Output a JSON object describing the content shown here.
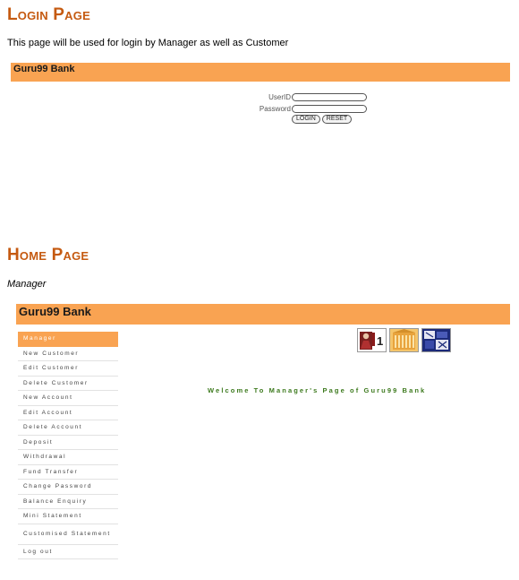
{
  "login_section": {
    "heading": "Login Page",
    "description": "This page will be used for login by Manager as well as Customer",
    "bank_title": "Guru99 Bank",
    "form": {
      "userid_label": "UserID",
      "password_label": "Password",
      "userid_value": "",
      "password_value": "",
      "login_button": "LOGIN",
      "reset_button": "RESET"
    }
  },
  "home_section": {
    "heading": "Home Page",
    "role_label": "Manager",
    "bank_title": "Guru99 Bank",
    "welcome_text": "Welcome To Manager's Page of Guru99 Bank",
    "icons": [
      "person-number-icon",
      "building-icon",
      "bank-tile-icon"
    ],
    "menu": [
      {
        "label": "Manager",
        "active": true
      },
      {
        "label": "New Customer"
      },
      {
        "label": "Edit Customer"
      },
      {
        "label": "Delete Customer"
      },
      {
        "label": "New Account"
      },
      {
        "label": "Edit Account"
      },
      {
        "label": "Delete Account"
      },
      {
        "label": "Deposit"
      },
      {
        "label": "Withdrawal"
      },
      {
        "label": "Fund Transfer"
      },
      {
        "label": "Change Password"
      },
      {
        "label": "Balance Enquiry"
      },
      {
        "label": "Mini Statement"
      },
      {
        "label": "Customised Statement"
      },
      {
        "label": "Log out"
      }
    ]
  },
  "colors": {
    "heading": "#c55a11",
    "bar": "#f9a352",
    "welcome": "#3d7a1e"
  }
}
